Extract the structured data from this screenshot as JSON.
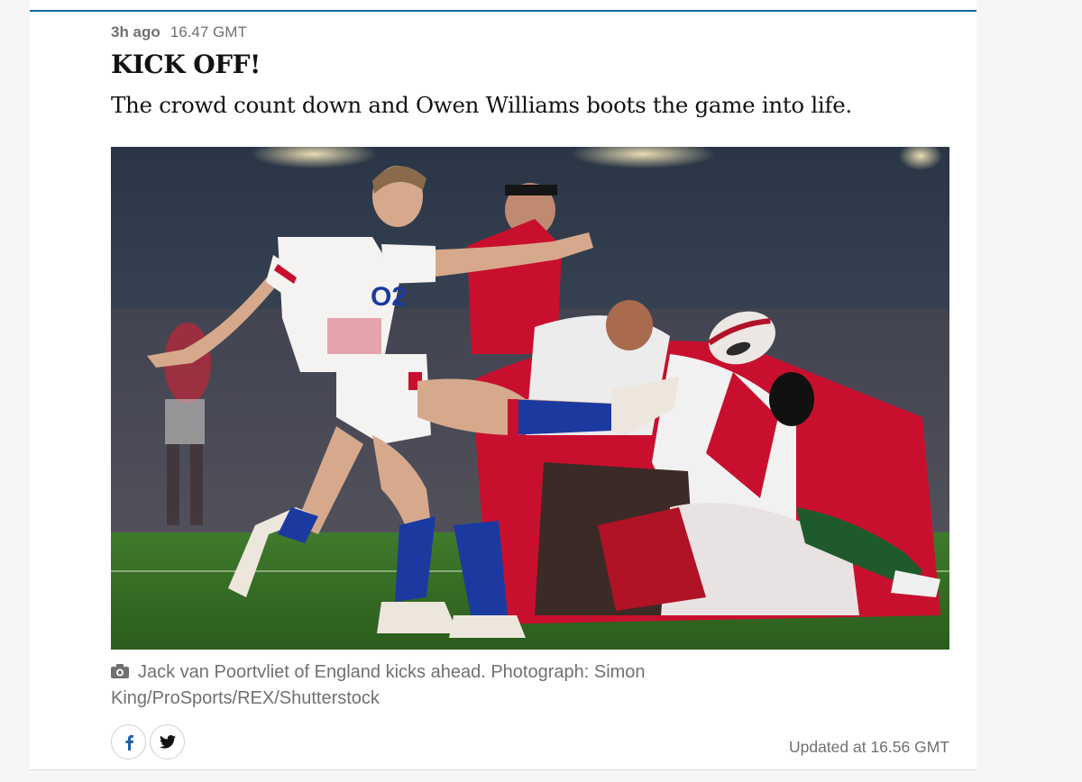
{
  "post": {
    "relative_time": "3h ago",
    "time": "16.47 GMT",
    "title": "KICK OFF!",
    "lede": "The crowd count down and Owen Williams boots the game into life.",
    "updated": "Updated at 16.56 GMT"
  },
  "image": {
    "alt": "Jack van Poortvliet of England kicks ahead",
    "shirt_logo": "O2"
  },
  "caption": {
    "icon": "camera-icon",
    "text": "Jack van Poortvliet of England kicks ahead. Photograph: Simon King/ProSports/REX/Shutterstock"
  },
  "share": {
    "facebook_icon": "facebook-icon",
    "twitter_icon": "twitter-icon"
  },
  "colors": {
    "accent": "#056da1",
    "text": "#121212",
    "muted": "#707070",
    "wales_red": "#c8102e",
    "england_blue": "#1b3aa0"
  }
}
